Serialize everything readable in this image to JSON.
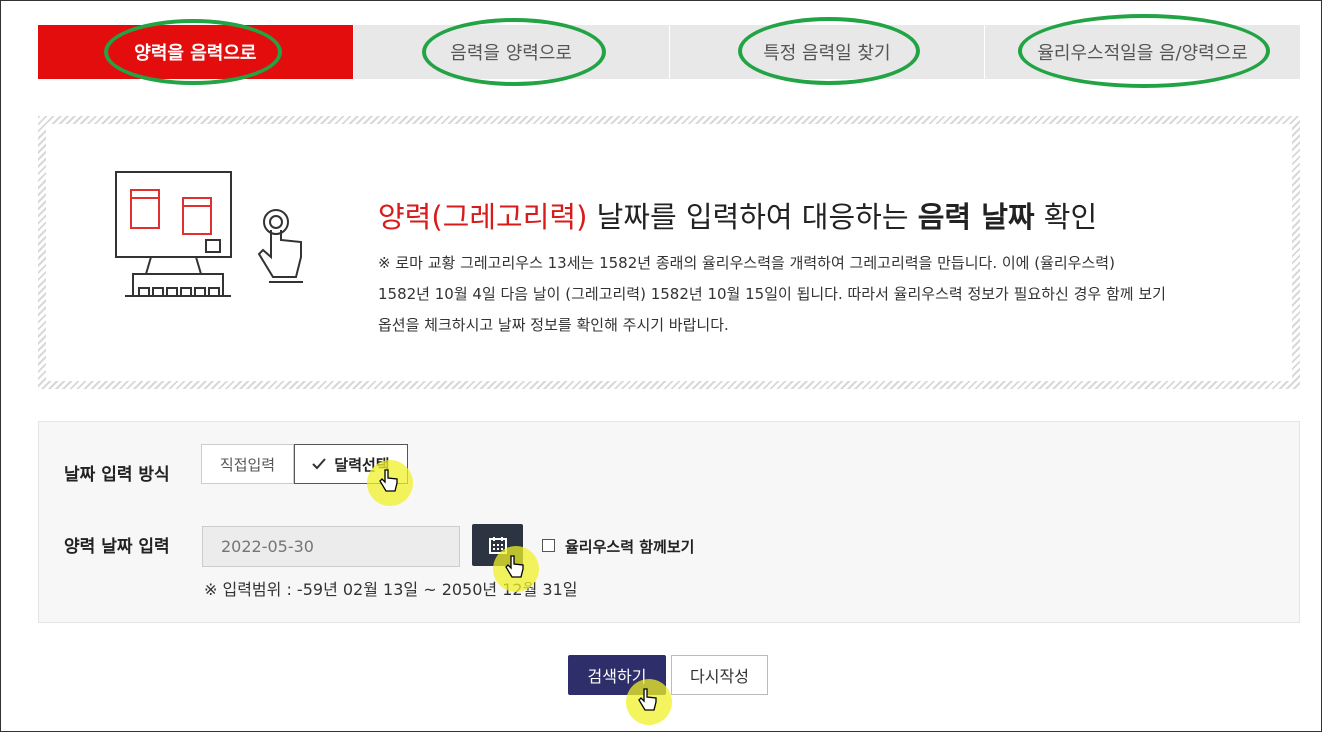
{
  "tabs": [
    {
      "label": "양력을 음력으로",
      "active": true
    },
    {
      "label": "음력을 양력으로",
      "active": false
    },
    {
      "label": "특정 음력일 찾기",
      "active": false
    },
    {
      "label": "율리우스적일을 음/양력으로",
      "active": false
    }
  ],
  "info": {
    "title_red": "양력(그레고리력)",
    "title_mid": " 날짜를 입력하여 대응하는 ",
    "title_bold": "음력 날짜",
    "title_end": " 확인",
    "desc_line1": "※ 로마 교황 그레고리우스 13세는 1582년 종래의 율리우스력을 개력하여 그레고리력을 만듭니다. 이에 (율리우스력)",
    "desc_line2": "1582년 10월 4일 다음 날이 (그레고리력) 1582년 10월 15일이 됩니다. 따라서 율리우스력 정보가 필요하신 경우 함께 보기",
    "desc_line3": "옵션을 체크하시고 날짜 정보를 확인해 주시기 바랍니다.",
    "illustration_icon": "computer-touch-icon"
  },
  "form": {
    "method_label": "날짜 입력 방식",
    "method_options": [
      "직접입력",
      "달력선택"
    ],
    "method_selected": "달력선택",
    "date_label": "양력 날짜 입력",
    "date_placeholder": "2022-05-30",
    "calendar_icon": "calendar-icon",
    "julian_checkbox_label": "율리우스력 함께보기",
    "julian_checked": false,
    "range_note": "※ 입력범위 : -59년 02월 13일 ~ 2050년 12월 31일"
  },
  "buttons": {
    "search": "검색하기",
    "reset": "다시작성"
  },
  "colors": {
    "active_tab": "#e30d0d",
    "annotation_ring": "#22a344",
    "search_button": "#2e2e6a",
    "calendar_button": "#2b3440",
    "cursor_highlight": "#f0f028"
  }
}
